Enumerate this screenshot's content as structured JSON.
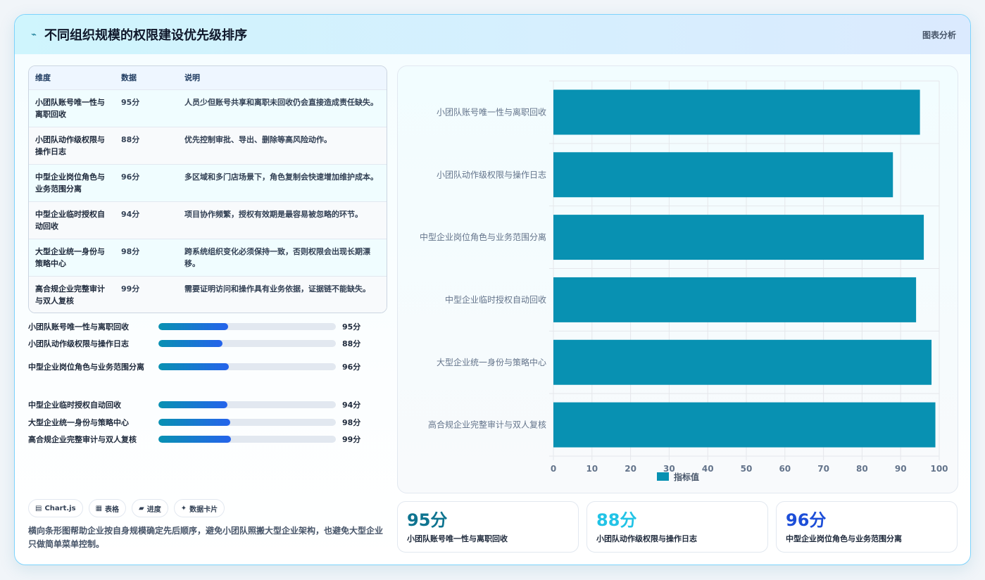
{
  "header": {
    "icon": "chart-icon",
    "title": "不同组织规模的权限建设优先级排序",
    "tag": "图表分析"
  },
  "table": {
    "headers": [
      "维度",
      "数据",
      "说明"
    ],
    "rows": [
      {
        "name": "小团队账号唯一性与离职回收",
        "value": "95分",
        "desc": "人员少但账号共享和离职未回收仍会直接造成责任缺失。"
      },
      {
        "name": "小团队动作级权限与操作日志",
        "value": "88分",
        "desc": "优先控制审批、导出、删除等高风险动作。"
      },
      {
        "name": "中型企业岗位角色与业务范围分离",
        "value": "96分",
        "desc": "多区域和多门店场景下，角色复制会快速增加维护成本。"
      },
      {
        "name": "中型企业临时授权自动回收",
        "value": "94分",
        "desc": "项目协作频繁，授权有效期是最容易被忽略的环节。"
      },
      {
        "name": "大型企业统一身份与策略中心",
        "value": "98分",
        "desc": "跨系统组织变化必须保持一致，否则权限会出现长期漂移。"
      },
      {
        "name": "高合规企业完整审计与双人复核",
        "value": "99分",
        "desc": "需要证明访问和操作具有业务依据，证据链不能缺失。"
      }
    ]
  },
  "progress": [
    {
      "label": "小团队账号唯一性与离职回收",
      "value": "95分",
      "pct": 95
    },
    {
      "label": "小团队动作级权限与操作日志",
      "value": "88分",
      "pct": 88
    },
    {
      "label": "中型企业岗位角色与业务范围分离",
      "value": "96分",
      "pct": 96
    },
    {
      "label": "中型企业临时授权自动回收",
      "value": "94分",
      "pct": 94
    },
    {
      "label": "大型企业统一身份与策略中心",
      "value": "98分",
      "pct": 98
    },
    {
      "label": "高合规企业完整审计与双人复核",
      "value": "99分",
      "pct": 99
    }
  ],
  "chips": [
    {
      "icon": "▤",
      "label": "Chart.js"
    },
    {
      "icon": "▦",
      "label": "表格"
    },
    {
      "icon": "▰",
      "label": "进度"
    },
    {
      "icon": "✦",
      "label": "数据卡片"
    }
  ],
  "note": "横向条形图帮助企业按自身规模确定先后顺序，避免小团队照搬大型企业架构，也避免大型企业只做简单菜单控制。",
  "stats": [
    {
      "value": "95分",
      "label": "小团队账号唯一性与离职回收",
      "color": "#0e7490"
    },
    {
      "value": "88分",
      "label": "小团队动作级权限与操作日志",
      "color": "#22c3e6"
    },
    {
      "value": "96分",
      "label": "中型企业岗位角色与业务范围分离",
      "color": "#1d4ed8"
    }
  ],
  "chart_data": {
    "type": "bar",
    "orientation": "horizontal",
    "categories": [
      "小团队账号唯一性与离职回收",
      "小团队动作级权限与操作日志",
      "中型企业岗位角色与业务范围分离",
      "中型企业临时授权自动回收",
      "大型企业统一身份与策略中心",
      "高合规企业完整审计与双人复核"
    ],
    "series": [
      {
        "name": "指标值",
        "values": [
          95,
          88,
          96,
          94,
          98,
          99
        ],
        "color": "#0891b2"
      }
    ],
    "xlim": [
      0,
      100
    ],
    "ticks": [
      "0",
      "10",
      "20",
      "30",
      "40",
      "50",
      "60",
      "70",
      "80",
      "90",
      "100"
    ],
    "grid": true,
    "legend": "bottom"
  }
}
